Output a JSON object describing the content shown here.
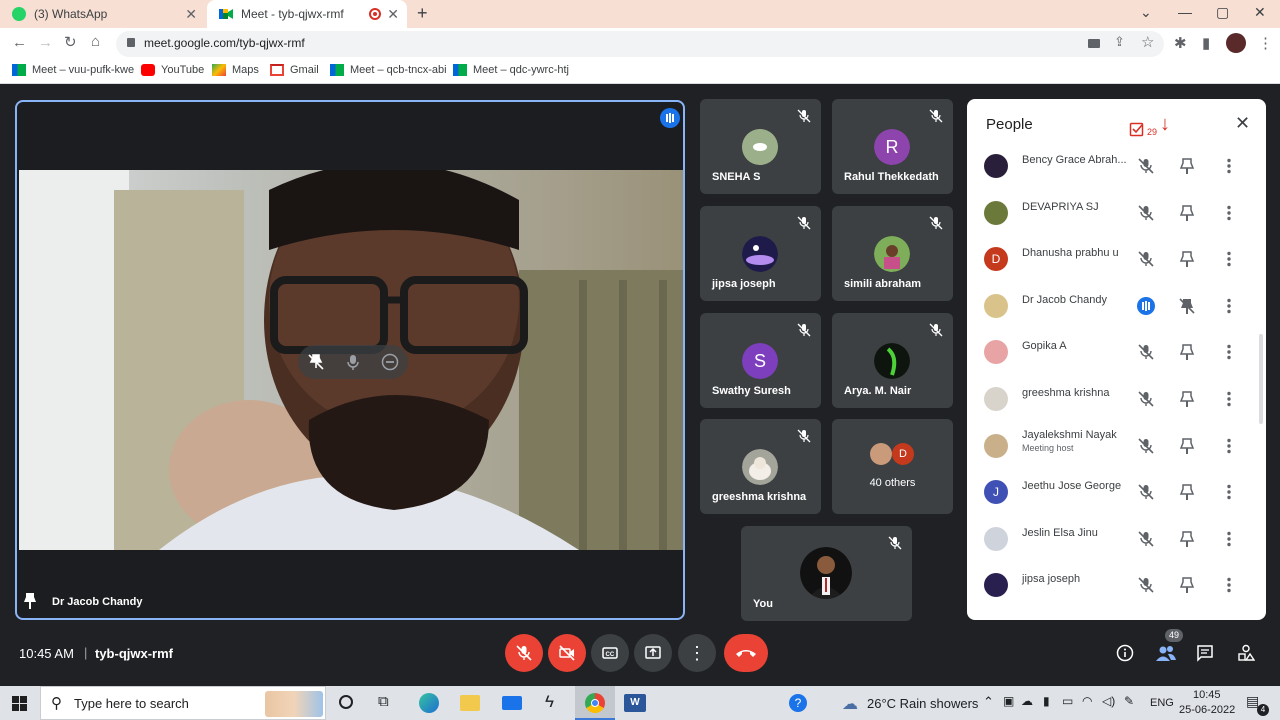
{
  "browser": {
    "tabs": [
      {
        "label": "(3) WhatsApp",
        "active": false
      },
      {
        "label": "Meet - tyb-qjwx-rmf",
        "active": true
      }
    ],
    "url": "meet.google.com/tyb-qjwx-rmf",
    "bookmarks": [
      {
        "label": "Meet – vuu-pufk-kwe",
        "icon": "meet-icon"
      },
      {
        "label": "YouTube",
        "icon": "youtube-icon"
      },
      {
        "label": "Maps",
        "icon": "maps-icon"
      },
      {
        "label": "Gmail",
        "icon": "gmail-icon"
      },
      {
        "label": "Meet – qcb-tncx-abi",
        "icon": "meet-icon"
      },
      {
        "label": "Meet – qdc-ywrc-htj",
        "icon": "meet-icon"
      }
    ]
  },
  "meet": {
    "main_speaker": {
      "name": "Dr Jacob Chandy"
    },
    "tiles": [
      {
        "name": "SNEHA S",
        "avatar": "image"
      },
      {
        "name": "Rahul Thekkedath",
        "avatar": "letter",
        "letter": "R",
        "color": "#8e44ad"
      },
      {
        "name": "jipsa joseph",
        "avatar": "image"
      },
      {
        "name": "simili abraham",
        "avatar": "image"
      },
      {
        "name": "Swathy Suresh",
        "avatar": "letter",
        "letter": "S",
        "color": "#7e3fbf"
      },
      {
        "name": "Arya. M. Nair",
        "avatar": "image"
      },
      {
        "name": "greeshma krishna",
        "avatar": "image"
      },
      {
        "name": "40 others",
        "avatar": "group",
        "letter": "D"
      }
    ],
    "self_tile": {
      "name": "You"
    },
    "bottom": {
      "time": "10:45 AM",
      "separator": "|",
      "meeting_code": "tyb-qjwx-rmf",
      "people_count": "49"
    }
  },
  "people_panel": {
    "title": "People",
    "raised_count": "29",
    "participants": [
      {
        "name": "Bency Grace Abrah...",
        "sub": "",
        "avatar": "image",
        "speaking": false
      },
      {
        "name": "DEVAPRIYA SJ",
        "sub": "",
        "avatar": "image",
        "speaking": false
      },
      {
        "name": "Dhanusha prabhu u",
        "sub": "",
        "avatar": "letter",
        "letter": "D",
        "color": "#c5391c",
        "speaking": false
      },
      {
        "name": "Dr Jacob Chandy",
        "sub": "",
        "avatar": "image",
        "speaking": true
      },
      {
        "name": "Gopika A",
        "sub": "",
        "avatar": "image",
        "speaking": false
      },
      {
        "name": "greeshma krishna",
        "sub": "",
        "avatar": "image",
        "speaking": false
      },
      {
        "name": "Jayalekshmi Nayak",
        "sub": "Meeting host",
        "avatar": "image",
        "speaking": false
      },
      {
        "name": "Jeethu Jose George",
        "sub": "",
        "avatar": "letter",
        "letter": "J",
        "color": "#3f51b5",
        "speaking": false
      },
      {
        "name": "Jeslin Elsa Jinu",
        "sub": "",
        "avatar": "image",
        "speaking": false
      },
      {
        "name": "jipsa joseph",
        "sub": "",
        "avatar": "image",
        "speaking": false
      }
    ]
  },
  "taskbar": {
    "search_placeholder": "Type here to search",
    "weather": "26°C  Rain showers",
    "lang": "ENG",
    "clock_time": "10:45",
    "clock_date": "25-06-2022",
    "notification_count": "4"
  },
  "colors": {
    "meet_bg": "#202124",
    "tile_bg": "#3c4043",
    "end_call_red": "#ea4335",
    "active_speaker_border": "#8ab4f8",
    "accent_blue": "#1a73e8"
  }
}
